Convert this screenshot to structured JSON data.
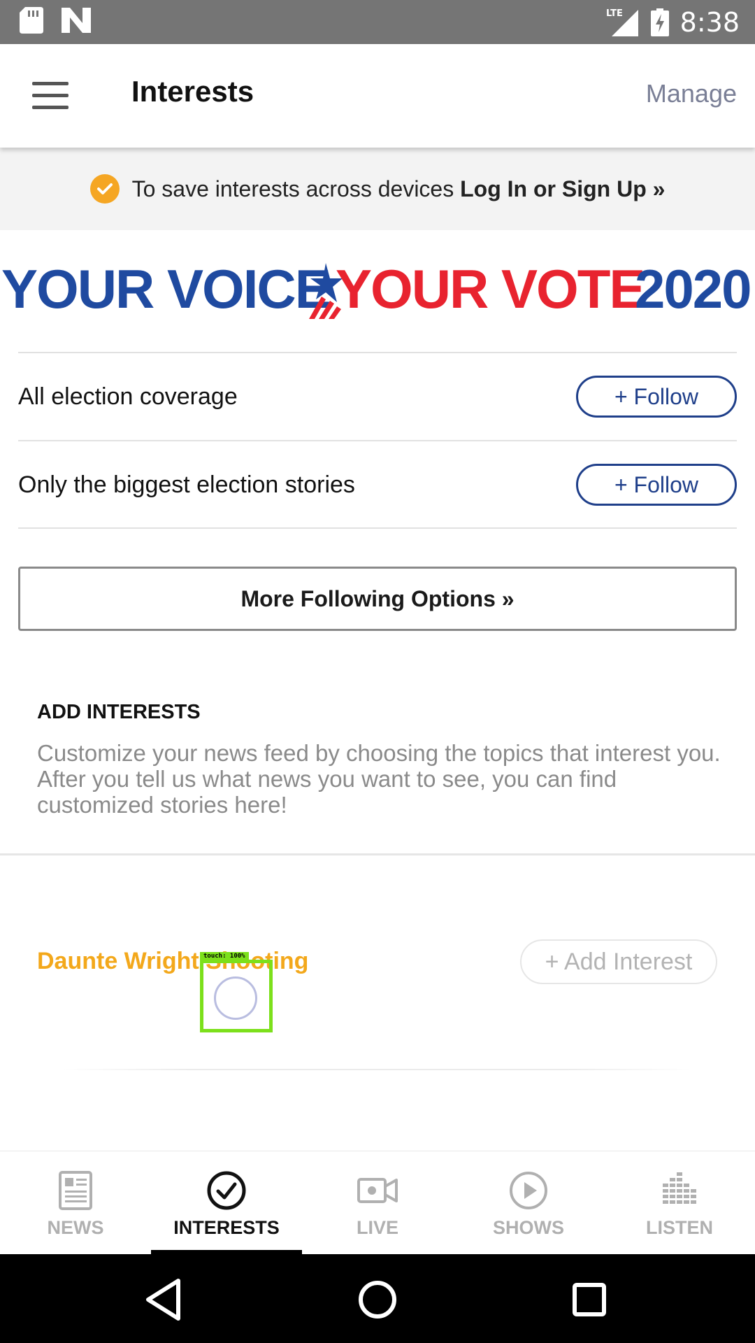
{
  "status_bar": {
    "time": "8:38",
    "network": "LTE",
    "icons": [
      "sd-card-icon",
      "n-logo-icon",
      "lte-signal-icon",
      "battery-charging-icon"
    ]
  },
  "header": {
    "title": "Interests",
    "manage_label": "Manage",
    "menu_icon": "hamburger-menu-icon"
  },
  "banner": {
    "text": "To save interests across devices ",
    "link": "Log In or Sign Up »",
    "accent": "#f5a623"
  },
  "election": {
    "logo_part1": "YOUR VOICE",
    "logo_part2": "YOUR VOTE",
    "logo_year": "2020",
    "blue": "#1f4aa0",
    "red": "#e8232f",
    "rows": [
      {
        "label": "All election coverage",
        "button": "+ Follow"
      },
      {
        "label": "Only the biggest election stories",
        "button": "+ Follow"
      }
    ],
    "more_options": "More Following Options »"
  },
  "add_interests": {
    "title": "ADD INTERESTS",
    "description": "Customize your news feed by choosing the topics that interest you. After you tell us what news you want to see, you can find customized stories here!"
  },
  "suggested_interest": {
    "name": "Daunte Wright Shooting",
    "button": "+ Add Interest",
    "color": "#f3a81b"
  },
  "touch_overlay": {
    "label": "touch: 100%"
  },
  "tabs": [
    {
      "label": "NEWS",
      "icon": "newspaper-icon",
      "active": false
    },
    {
      "label": "INTERESTS",
      "icon": "check-circle-icon",
      "active": true
    },
    {
      "label": "LIVE",
      "icon": "video-camera-icon",
      "active": false
    },
    {
      "label": "SHOWS",
      "icon": "play-circle-icon",
      "active": false
    },
    {
      "label": "LISTEN",
      "icon": "equalizer-icon",
      "active": false
    }
  ],
  "nav_bar": {
    "icons": [
      "back-icon",
      "home-icon",
      "recents-icon"
    ]
  }
}
